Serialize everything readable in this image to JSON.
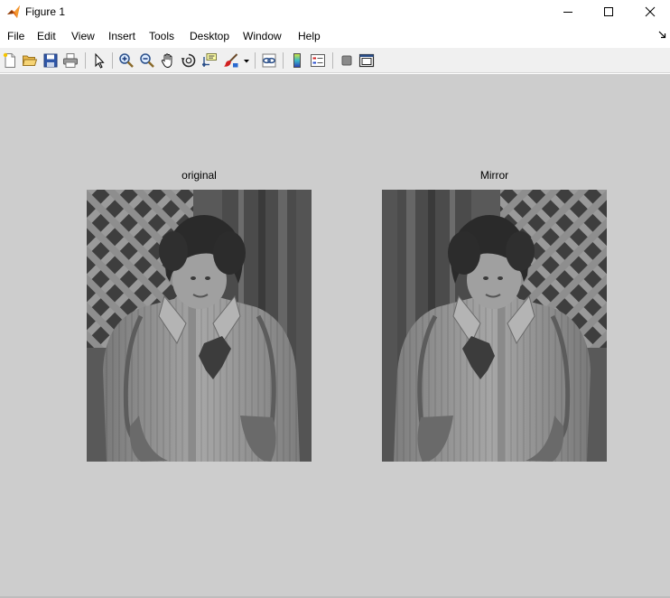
{
  "window": {
    "title": "Figure 1",
    "controls": [
      "minimize",
      "maximize",
      "close"
    ]
  },
  "menu": {
    "items": [
      "File",
      "Edit",
      "View",
      "Insert",
      "Tools",
      "Desktop",
      "Window",
      "Help"
    ]
  },
  "toolbar": {
    "buttons": [
      "new-figure-icon",
      "open-file-icon",
      "save-icon",
      "print-icon",
      "edit-plot-icon",
      "zoom-in-icon",
      "zoom-out-icon",
      "pan-icon",
      "rotate-3d-icon",
      "data-cursor-icon",
      "brush-icon",
      "link-plot-icon",
      "colorbar-icon",
      "legend-icon",
      "hide-plot-tools-icon",
      "show-plot-tools-icon"
    ]
  },
  "figure": {
    "background": "#cdcdcd",
    "axes": [
      {
        "title": "original",
        "image": "grayscale photo of a child in a jacket",
        "flipped": false
      },
      {
        "title": "Mirror",
        "image": "grayscale photo of a child in a jacket",
        "flipped": true
      }
    ]
  }
}
